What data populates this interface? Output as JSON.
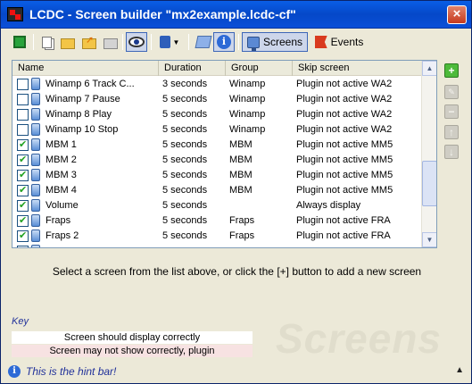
{
  "window": {
    "title": "LCDC - Screen builder \"mx2example.lcdc-cf\"",
    "close": "×"
  },
  "toolbar": {
    "screens_label": "Screens",
    "events_label": "Events",
    "info_glyph": "i"
  },
  "list": {
    "columns": [
      "Name",
      "Duration",
      "Group",
      "Skip screen"
    ],
    "rows": [
      {
        "checked": false,
        "name": "Winamp 6 Track C...",
        "duration": "3 seconds",
        "group": "Winamp",
        "skip": "Plugin not active WA2"
      },
      {
        "checked": false,
        "name": "Winamp 7 Pause",
        "duration": "5 seconds",
        "group": "Winamp",
        "skip": "Plugin not active WA2"
      },
      {
        "checked": false,
        "name": "Winamp 8 Play",
        "duration": "5 seconds",
        "group": "Winamp",
        "skip": "Plugin not active WA2"
      },
      {
        "checked": false,
        "name": "Winamp 10 Stop",
        "duration": "5 seconds",
        "group": "Winamp",
        "skip": "Plugin not active WA2"
      },
      {
        "checked": true,
        "name": "MBM 1",
        "duration": "5 seconds",
        "group": "MBM",
        "skip": "Plugin not active MM5"
      },
      {
        "checked": true,
        "name": "MBM 2",
        "duration": "5 seconds",
        "group": "MBM",
        "skip": "Plugin not active MM5"
      },
      {
        "checked": true,
        "name": "MBM 3",
        "duration": "5 seconds",
        "group": "MBM",
        "skip": "Plugin not active MM5"
      },
      {
        "checked": true,
        "name": "MBM 4",
        "duration": "5 seconds",
        "group": "MBM",
        "skip": "Plugin not active MM5"
      },
      {
        "checked": true,
        "name": "Volume",
        "duration": "5 seconds",
        "group": "",
        "skip": "Always display"
      },
      {
        "checked": true,
        "name": "Fraps",
        "duration": "5 seconds",
        "group": "Fraps",
        "skip": "Plugin not active FRA"
      },
      {
        "checked": true,
        "name": "Fraps 2",
        "duration": "5 seconds",
        "group": "Fraps",
        "skip": "Plugin not active FRA"
      },
      {
        "checked": false,
        "name": "",
        "duration": "",
        "group": "",
        "skip": ""
      }
    ]
  },
  "side_buttons": {
    "add": "+",
    "edit": "✎",
    "remove": "−",
    "up": "↑",
    "down": "↓"
  },
  "status": {
    "message": "Select a screen from the list above, or click the [+] button to add a new screen"
  },
  "watermark": "Screens",
  "key": {
    "label": "Key",
    "ok": {
      "text": "Screen should display correctly",
      "color": "#ffffff"
    },
    "warn": {
      "text": "Screen may not show correctly, plugin",
      "color": "#f7e2e2"
    }
  },
  "hint": {
    "text": "This is the hint bar!",
    "up_arrow": "▲"
  }
}
